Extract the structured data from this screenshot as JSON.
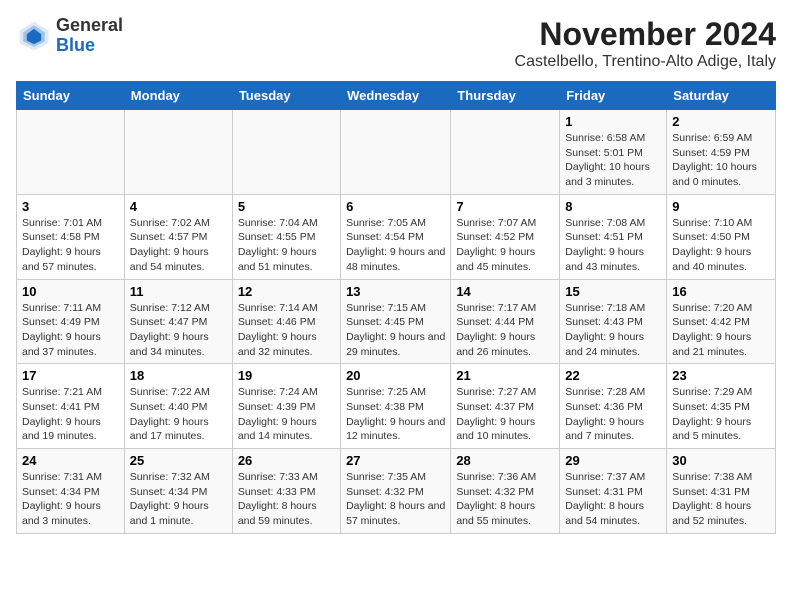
{
  "header": {
    "logo_line1": "General",
    "logo_line2": "Blue",
    "month_title": "November 2024",
    "location": "Castelbello, Trentino-Alto Adige, Italy"
  },
  "columns": [
    "Sunday",
    "Monday",
    "Tuesday",
    "Wednesday",
    "Thursday",
    "Friday",
    "Saturday"
  ],
  "weeks": [
    [
      {
        "day": "",
        "detail": ""
      },
      {
        "day": "",
        "detail": ""
      },
      {
        "day": "",
        "detail": ""
      },
      {
        "day": "",
        "detail": ""
      },
      {
        "day": "",
        "detail": ""
      },
      {
        "day": "1",
        "detail": "Sunrise: 6:58 AM\nSunset: 5:01 PM\nDaylight: 10 hours and 3 minutes."
      },
      {
        "day": "2",
        "detail": "Sunrise: 6:59 AM\nSunset: 4:59 PM\nDaylight: 10 hours and 0 minutes."
      }
    ],
    [
      {
        "day": "3",
        "detail": "Sunrise: 7:01 AM\nSunset: 4:58 PM\nDaylight: 9 hours and 57 minutes."
      },
      {
        "day": "4",
        "detail": "Sunrise: 7:02 AM\nSunset: 4:57 PM\nDaylight: 9 hours and 54 minutes."
      },
      {
        "day": "5",
        "detail": "Sunrise: 7:04 AM\nSunset: 4:55 PM\nDaylight: 9 hours and 51 minutes."
      },
      {
        "day": "6",
        "detail": "Sunrise: 7:05 AM\nSunset: 4:54 PM\nDaylight: 9 hours and 48 minutes."
      },
      {
        "day": "7",
        "detail": "Sunrise: 7:07 AM\nSunset: 4:52 PM\nDaylight: 9 hours and 45 minutes."
      },
      {
        "day": "8",
        "detail": "Sunrise: 7:08 AM\nSunset: 4:51 PM\nDaylight: 9 hours and 43 minutes."
      },
      {
        "day": "9",
        "detail": "Sunrise: 7:10 AM\nSunset: 4:50 PM\nDaylight: 9 hours and 40 minutes."
      }
    ],
    [
      {
        "day": "10",
        "detail": "Sunrise: 7:11 AM\nSunset: 4:49 PM\nDaylight: 9 hours and 37 minutes."
      },
      {
        "day": "11",
        "detail": "Sunrise: 7:12 AM\nSunset: 4:47 PM\nDaylight: 9 hours and 34 minutes."
      },
      {
        "day": "12",
        "detail": "Sunrise: 7:14 AM\nSunset: 4:46 PM\nDaylight: 9 hours and 32 minutes."
      },
      {
        "day": "13",
        "detail": "Sunrise: 7:15 AM\nSunset: 4:45 PM\nDaylight: 9 hours and 29 minutes."
      },
      {
        "day": "14",
        "detail": "Sunrise: 7:17 AM\nSunset: 4:44 PM\nDaylight: 9 hours and 26 minutes."
      },
      {
        "day": "15",
        "detail": "Sunrise: 7:18 AM\nSunset: 4:43 PM\nDaylight: 9 hours and 24 minutes."
      },
      {
        "day": "16",
        "detail": "Sunrise: 7:20 AM\nSunset: 4:42 PM\nDaylight: 9 hours and 21 minutes."
      }
    ],
    [
      {
        "day": "17",
        "detail": "Sunrise: 7:21 AM\nSunset: 4:41 PM\nDaylight: 9 hours and 19 minutes."
      },
      {
        "day": "18",
        "detail": "Sunrise: 7:22 AM\nSunset: 4:40 PM\nDaylight: 9 hours and 17 minutes."
      },
      {
        "day": "19",
        "detail": "Sunrise: 7:24 AM\nSunset: 4:39 PM\nDaylight: 9 hours and 14 minutes."
      },
      {
        "day": "20",
        "detail": "Sunrise: 7:25 AM\nSunset: 4:38 PM\nDaylight: 9 hours and 12 minutes."
      },
      {
        "day": "21",
        "detail": "Sunrise: 7:27 AM\nSunset: 4:37 PM\nDaylight: 9 hours and 10 minutes."
      },
      {
        "day": "22",
        "detail": "Sunrise: 7:28 AM\nSunset: 4:36 PM\nDaylight: 9 hours and 7 minutes."
      },
      {
        "day": "23",
        "detail": "Sunrise: 7:29 AM\nSunset: 4:35 PM\nDaylight: 9 hours and 5 minutes."
      }
    ],
    [
      {
        "day": "24",
        "detail": "Sunrise: 7:31 AM\nSunset: 4:34 PM\nDaylight: 9 hours and 3 minutes."
      },
      {
        "day": "25",
        "detail": "Sunrise: 7:32 AM\nSunset: 4:34 PM\nDaylight: 9 hours and 1 minute."
      },
      {
        "day": "26",
        "detail": "Sunrise: 7:33 AM\nSunset: 4:33 PM\nDaylight: 8 hours and 59 minutes."
      },
      {
        "day": "27",
        "detail": "Sunrise: 7:35 AM\nSunset: 4:32 PM\nDaylight: 8 hours and 57 minutes."
      },
      {
        "day": "28",
        "detail": "Sunrise: 7:36 AM\nSunset: 4:32 PM\nDaylight: 8 hours and 55 minutes."
      },
      {
        "day": "29",
        "detail": "Sunrise: 7:37 AM\nSunset: 4:31 PM\nDaylight: 8 hours and 54 minutes."
      },
      {
        "day": "30",
        "detail": "Sunrise: 7:38 AM\nSunset: 4:31 PM\nDaylight: 8 hours and 52 minutes."
      }
    ]
  ]
}
